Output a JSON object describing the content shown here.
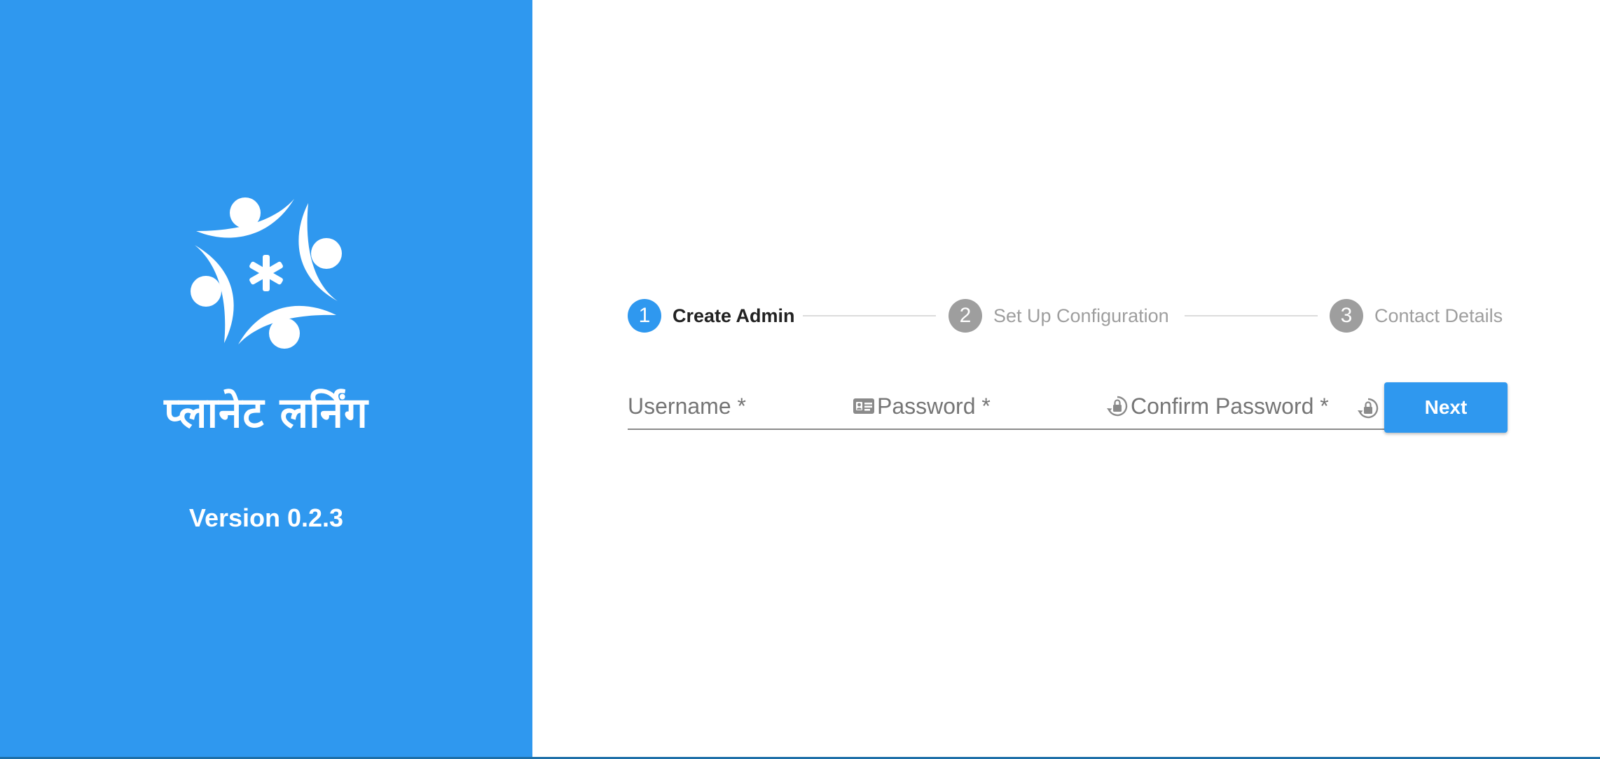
{
  "brand": {
    "name": "प्लानेट लर्निंग",
    "version": "Version 0.2.3",
    "panel_color": "#2f98ef",
    "logo_icon": "planet-learning-logo-icon"
  },
  "stepper": {
    "steps": [
      {
        "number": "1",
        "label": "Create Admin",
        "state": "active"
      },
      {
        "number": "2",
        "label": "Set Up Configuration",
        "state": "inactive"
      },
      {
        "number": "3",
        "label": "Contact Details",
        "state": "inactive"
      }
    ],
    "active_color": "#2f98ef",
    "inactive_color": "#9e9e9e"
  },
  "form": {
    "username": {
      "placeholder": "Username *",
      "value": "",
      "icon": "id-card-icon"
    },
    "password": {
      "placeholder": "Password *",
      "value": "",
      "icon": "lock-icon"
    },
    "confirm_password": {
      "placeholder": "Confirm Password *",
      "value": "",
      "icon": "lock-icon"
    },
    "next_label": "Next"
  }
}
